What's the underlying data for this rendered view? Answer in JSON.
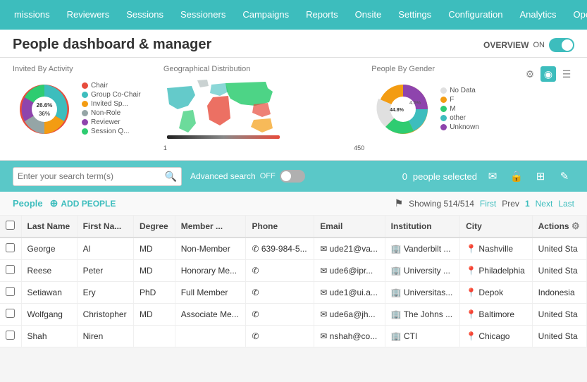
{
  "nav": {
    "items": [
      {
        "label": "missions",
        "active": false
      },
      {
        "label": "Reviewers",
        "active": false
      },
      {
        "label": "Sessions",
        "active": false
      },
      {
        "label": "Sessioners",
        "active": false
      },
      {
        "label": "Campaigns",
        "active": false
      },
      {
        "label": "Reports",
        "active": false
      },
      {
        "label": "Onsite",
        "active": false
      },
      {
        "label": "Settings",
        "active": false
      },
      {
        "label": "Configuration",
        "active": false
      },
      {
        "label": "Analytics",
        "active": false
      },
      {
        "label": "Operation",
        "active": false
      }
    ]
  },
  "header": {
    "title": "People dashboard & manager",
    "overview_label": "OVERVIEW",
    "overview_state": "ON"
  },
  "charts": {
    "settings_icon": "⚙",
    "pie_icon": "◉",
    "list_icon": "☰",
    "panel1": {
      "title": "Invited By Activity",
      "legend": [
        {
          "label": "Chair",
          "color": "#e74c3c"
        },
        {
          "label": "Group Co-Chair",
          "color": "#3dbdbd"
        },
        {
          "label": "Invited Sp...",
          "color": "#f39c12"
        },
        {
          "label": "Non-Role",
          "color": "#95a5a6"
        },
        {
          "label": "Reviewer",
          "color": "#8e44ad"
        },
        {
          "label": "Session Q...",
          "color": "#2ecc71"
        }
      ],
      "center_label1": "26.6%",
      "center_label2": "36%"
    },
    "panel2": {
      "title": "Geographical Distribution",
      "min_label": "1",
      "max_label": "450"
    },
    "panel3": {
      "title": "People By Gender",
      "center_label": "44.8%",
      "right_label": "4.6%",
      "legend": [
        {
          "label": "No Data",
          "color": "#e0e0e0"
        },
        {
          "label": "F",
          "color": "#f39c12"
        },
        {
          "label": "M",
          "color": "#2ecc71"
        },
        {
          "label": "other",
          "color": "#3dbdbd"
        },
        {
          "label": "Unknown",
          "color": "#8e44ad"
        }
      ]
    }
  },
  "toolbar": {
    "search_placeholder": "Enter your search term(s)",
    "advanced_label": "Advanced search",
    "advanced_state": "OFF",
    "selected_count": "0",
    "selected_label": "people selected",
    "email_icon": "✉",
    "lock_icon": "🔒",
    "grid_icon": "⊞",
    "edit_icon": "✎"
  },
  "people_bar": {
    "label": "People",
    "add_label": "ADD PEOPLE",
    "showing_label": "Showing 514/514",
    "first_label": "First",
    "prev_label": "Prev",
    "page_num": "1",
    "next_label": "Next",
    "last_label": "Last"
  },
  "table": {
    "columns": [
      "",
      "Last Name",
      "First Na...",
      "Degree",
      "Member ...",
      "Phone",
      "Email",
      "Institution",
      "City",
      "Actions ⚙"
    ],
    "rows": [
      {
        "last": "George",
        "first": "Al",
        "degree": "MD",
        "member": "Non-Member",
        "phone": "✆ 639-984-5...",
        "email": "✉ ude21@va...",
        "institution": "🏢 Vanderbilt ...",
        "city": "📍 Nashville",
        "country": "United Sta"
      },
      {
        "last": "Reese",
        "first": "Peter",
        "degree": "MD",
        "member": "Honorary Me...",
        "phone": "✆",
        "email": "✉ ude6@ipr...",
        "institution": "🏢 University ...",
        "city": "📍 Philadelphia",
        "country": "United Sta"
      },
      {
        "last": "Setiawan",
        "first": "Ery",
        "degree": "PhD",
        "member": "Full Member",
        "phone": "✆",
        "email": "✉ ude1@ui.a...",
        "institution": "🏢 Universitas...",
        "city": "📍 Depok",
        "country": "Indonesia"
      },
      {
        "last": "Wolfgang",
        "first": "Christopher",
        "degree": "MD",
        "member": "Associate Me...",
        "phone": "✆",
        "email": "✉ ude6a@jh...",
        "institution": "🏢 The Johns ...",
        "city": "📍 Baltimore",
        "country": "United Sta"
      },
      {
        "last": "Shah",
        "first": "Niren",
        "degree": "",
        "member": "",
        "phone": "✆",
        "email": "✉ nshah@co...",
        "institution": "🏢 CTI",
        "city": "📍 Chicago",
        "country": "United Sta"
      }
    ]
  }
}
